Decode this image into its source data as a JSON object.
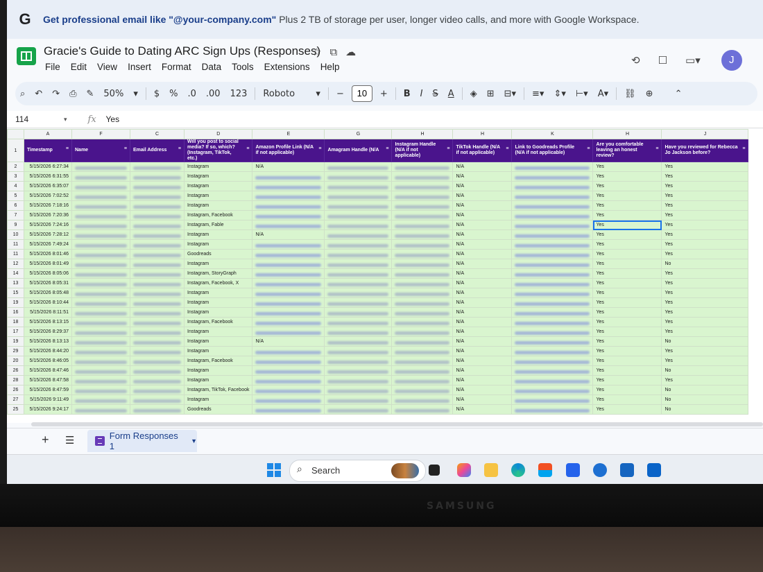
{
  "banner": {
    "logo": "G",
    "bold_text": "Get professional email like \"@your-company.com\"",
    "rest_text": " Plus 2 TB of storage per user, longer video calls, and more with Google Workspace."
  },
  "header": {
    "title": "Gracie's Guide to Dating ARC Sign Ups (Responses)",
    "menu": [
      "File",
      "Edit",
      "View",
      "Insert",
      "Format",
      "Data",
      "Tools",
      "Extensions",
      "Help"
    ],
    "avatar_letter": "J"
  },
  "toolbar": {
    "zoom": "50%",
    "currency": "$",
    "percent": "%",
    "dec_decrease": ".0",
    "dec_increase": ".00",
    "number_format": "123",
    "font": "Roboto",
    "font_size": "10",
    "minus": "−",
    "plus": "+",
    "bold": "B",
    "italic": "I",
    "strike": "S",
    "text_color": "A"
  },
  "formula": {
    "cell_ref": "114",
    "fx": "fx",
    "value": "Yes"
  },
  "grid": {
    "column_letters": [
      "A",
      "F",
      "C",
      "D",
      "E",
      "G",
      "H",
      "H",
      "K",
      "H",
      "J"
    ],
    "headers": [
      "Timestamp",
      "Name",
      "Email Address",
      "Will you post to social media? If so, which? (Instagram, TikTok, etc.)",
      "Amazon Profile Link (N/A if not applicable)",
      "Amagram Handle (N/A",
      "Instagram Handle (N/A if not applicable)",
      "TikTok Handle (N/A if not applicable)",
      "Link to Goodreads Profile (N/A if not applicable)",
      "Are you comfortable leaving an honest review?",
      "Have you reviewed for Rebecca Jo Jackson before?"
    ],
    "header_row_number": "1",
    "rows": [
      {
        "num": "2",
        "ts": "5/15/2026 6:27:34",
        "social": "Instagram",
        "amazon": "N/A",
        "tiktok": "N/A",
        "review": "Yes",
        "before": "Yes"
      },
      {
        "num": "3",
        "ts": "5/15/2026 6:31:55",
        "social": "Instagram",
        "amazon": "",
        "tiktok": "N/A",
        "review": "Yes",
        "before": "Yes"
      },
      {
        "num": "4",
        "ts": "5/15/2026 6:35:07",
        "social": "Instagram",
        "amazon": "",
        "tiktok": "N/A",
        "review": "Yes",
        "before": "Yes"
      },
      {
        "num": "5",
        "ts": "5/15/2026 7:02:52",
        "social": "Instagram",
        "amazon": "",
        "tiktok": "N/A",
        "review": "Yes",
        "before": "Yes"
      },
      {
        "num": "6",
        "ts": "5/15/2026 7:18:16",
        "social": "Instagram",
        "amazon": "",
        "tiktok": "N/A",
        "review": "Yes",
        "before": "Yes"
      },
      {
        "num": "7",
        "ts": "5/15/2026 7:20:36",
        "social": "Instagram, Facebook",
        "amazon": "",
        "tiktok": "N/A",
        "review": "Yes",
        "before": "Yes"
      },
      {
        "num": "9",
        "ts": "5/15/2026 7:24:16",
        "social": "Instagram, Fable",
        "amazon": "",
        "tiktok": "N/A",
        "review": "Yes",
        "before": "Yes",
        "selected": true
      },
      {
        "num": "10",
        "ts": "5/15/2026 7:28:12",
        "social": "Instagram",
        "amazon": "N/A",
        "tiktok": "N/A",
        "review": "Yes",
        "before": "Yes"
      },
      {
        "num": "11",
        "ts": "5/15/2026 7:49:24",
        "social": "Instagram",
        "amazon": "",
        "tiktok": "N/A",
        "review": "Yes",
        "before": "Yes"
      },
      {
        "num": "11",
        "ts": "5/15/2026 8:01:46",
        "social": "Goodreads",
        "amazon": "",
        "tiktok": "N/A",
        "review": "Yes",
        "before": "Yes"
      },
      {
        "num": "12",
        "ts": "5/15/2026 8:01:49",
        "social": "Instagram",
        "amazon": "",
        "tiktok": "N/A",
        "review": "Yes",
        "before": "No"
      },
      {
        "num": "14",
        "ts": "5/15/2026 8:05:06",
        "social": "Instagram, StoryGraph",
        "amazon": "",
        "tiktok": "N/A",
        "review": "Yes",
        "before": "Yes"
      },
      {
        "num": "13",
        "ts": "5/15/2026 8:05:31",
        "social": "Instagram, Facebook, X",
        "amazon": "",
        "tiktok": "N/A",
        "review": "Yes",
        "before": "Yes"
      },
      {
        "num": "15",
        "ts": "5/15/2026 8:05:48",
        "social": "Instagram",
        "amazon": "",
        "tiktok": "N/A",
        "review": "Yes",
        "before": "Yes"
      },
      {
        "num": "19",
        "ts": "5/15/2026 8:10:44",
        "social": "Instagram",
        "amazon": "",
        "tiktok": "N/A",
        "review": "Yes",
        "before": "Yes"
      },
      {
        "num": "16",
        "ts": "5/15/2026 8:11:51",
        "social": "Instagram",
        "amazon": "",
        "tiktok": "N/A",
        "review": "Yes",
        "before": "Yes"
      },
      {
        "num": "18",
        "ts": "5/15/2026 8:13:15",
        "social": "Instagram, Facebook",
        "amazon": "",
        "tiktok": "N/A",
        "review": "Yes",
        "before": "Yes"
      },
      {
        "num": "17",
        "ts": "5/15/2026 8:29:37",
        "social": "Instagram",
        "amazon": "",
        "tiktok": "N/A",
        "review": "Yes",
        "before": "Yes"
      },
      {
        "num": "19",
        "ts": "5/15/2026 8:13:13",
        "social": "Instagram",
        "amazon": "N/A",
        "tiktok": "N/A",
        "review": "Yes",
        "before": "No"
      },
      {
        "num": "29",
        "ts": "5/15/2026 8:44:20",
        "social": "Instagram",
        "amazon": "",
        "tiktok": "N/A",
        "review": "Yes",
        "before": "Yes"
      },
      {
        "num": "20",
        "ts": "5/15/2026 8:46:05",
        "social": "Instagram, Facebook",
        "amazon": "",
        "tiktok": "N/A",
        "review": "Yes",
        "before": "Yes"
      },
      {
        "num": "26",
        "ts": "5/15/2026 8:47:46",
        "social": "Instagram",
        "amazon": "",
        "tiktok": "N/A",
        "review": "Yes",
        "before": "No"
      },
      {
        "num": "28",
        "ts": "5/15/2026 8:47:58",
        "social": "Instagram",
        "amazon": "",
        "tiktok": "N/A",
        "review": "Yes",
        "before": "Yes"
      },
      {
        "num": "26",
        "ts": "5/15/2026 8:47:59",
        "social": "Instagram, TikTok, Facebook",
        "amazon": "",
        "tiktok": "N/A",
        "review": "Yes",
        "before": "No"
      },
      {
        "num": "27",
        "ts": "5/15/2026 9:11:49",
        "social": "Instagram",
        "amazon": "",
        "tiktok": "N/A",
        "review": "Yes",
        "before": "No"
      },
      {
        "num": "25",
        "ts": "5/15/2026 9:24:17",
        "social": "Goodreads",
        "amazon": "",
        "tiktok": "N/A",
        "review": "Yes",
        "before": "No"
      }
    ]
  },
  "sheets": {
    "add": "+",
    "list": "☰",
    "active_tab": "Form Responses 1"
  },
  "taskbar": {
    "search_label": "Search"
  },
  "monitor": {
    "brand": "SAMSUNG"
  },
  "colors": {
    "header_purple": "#4a148c",
    "row_green": "#d9f5cf",
    "selection_blue": "#1a73e8",
    "banner_bg": "#e8eef7"
  }
}
